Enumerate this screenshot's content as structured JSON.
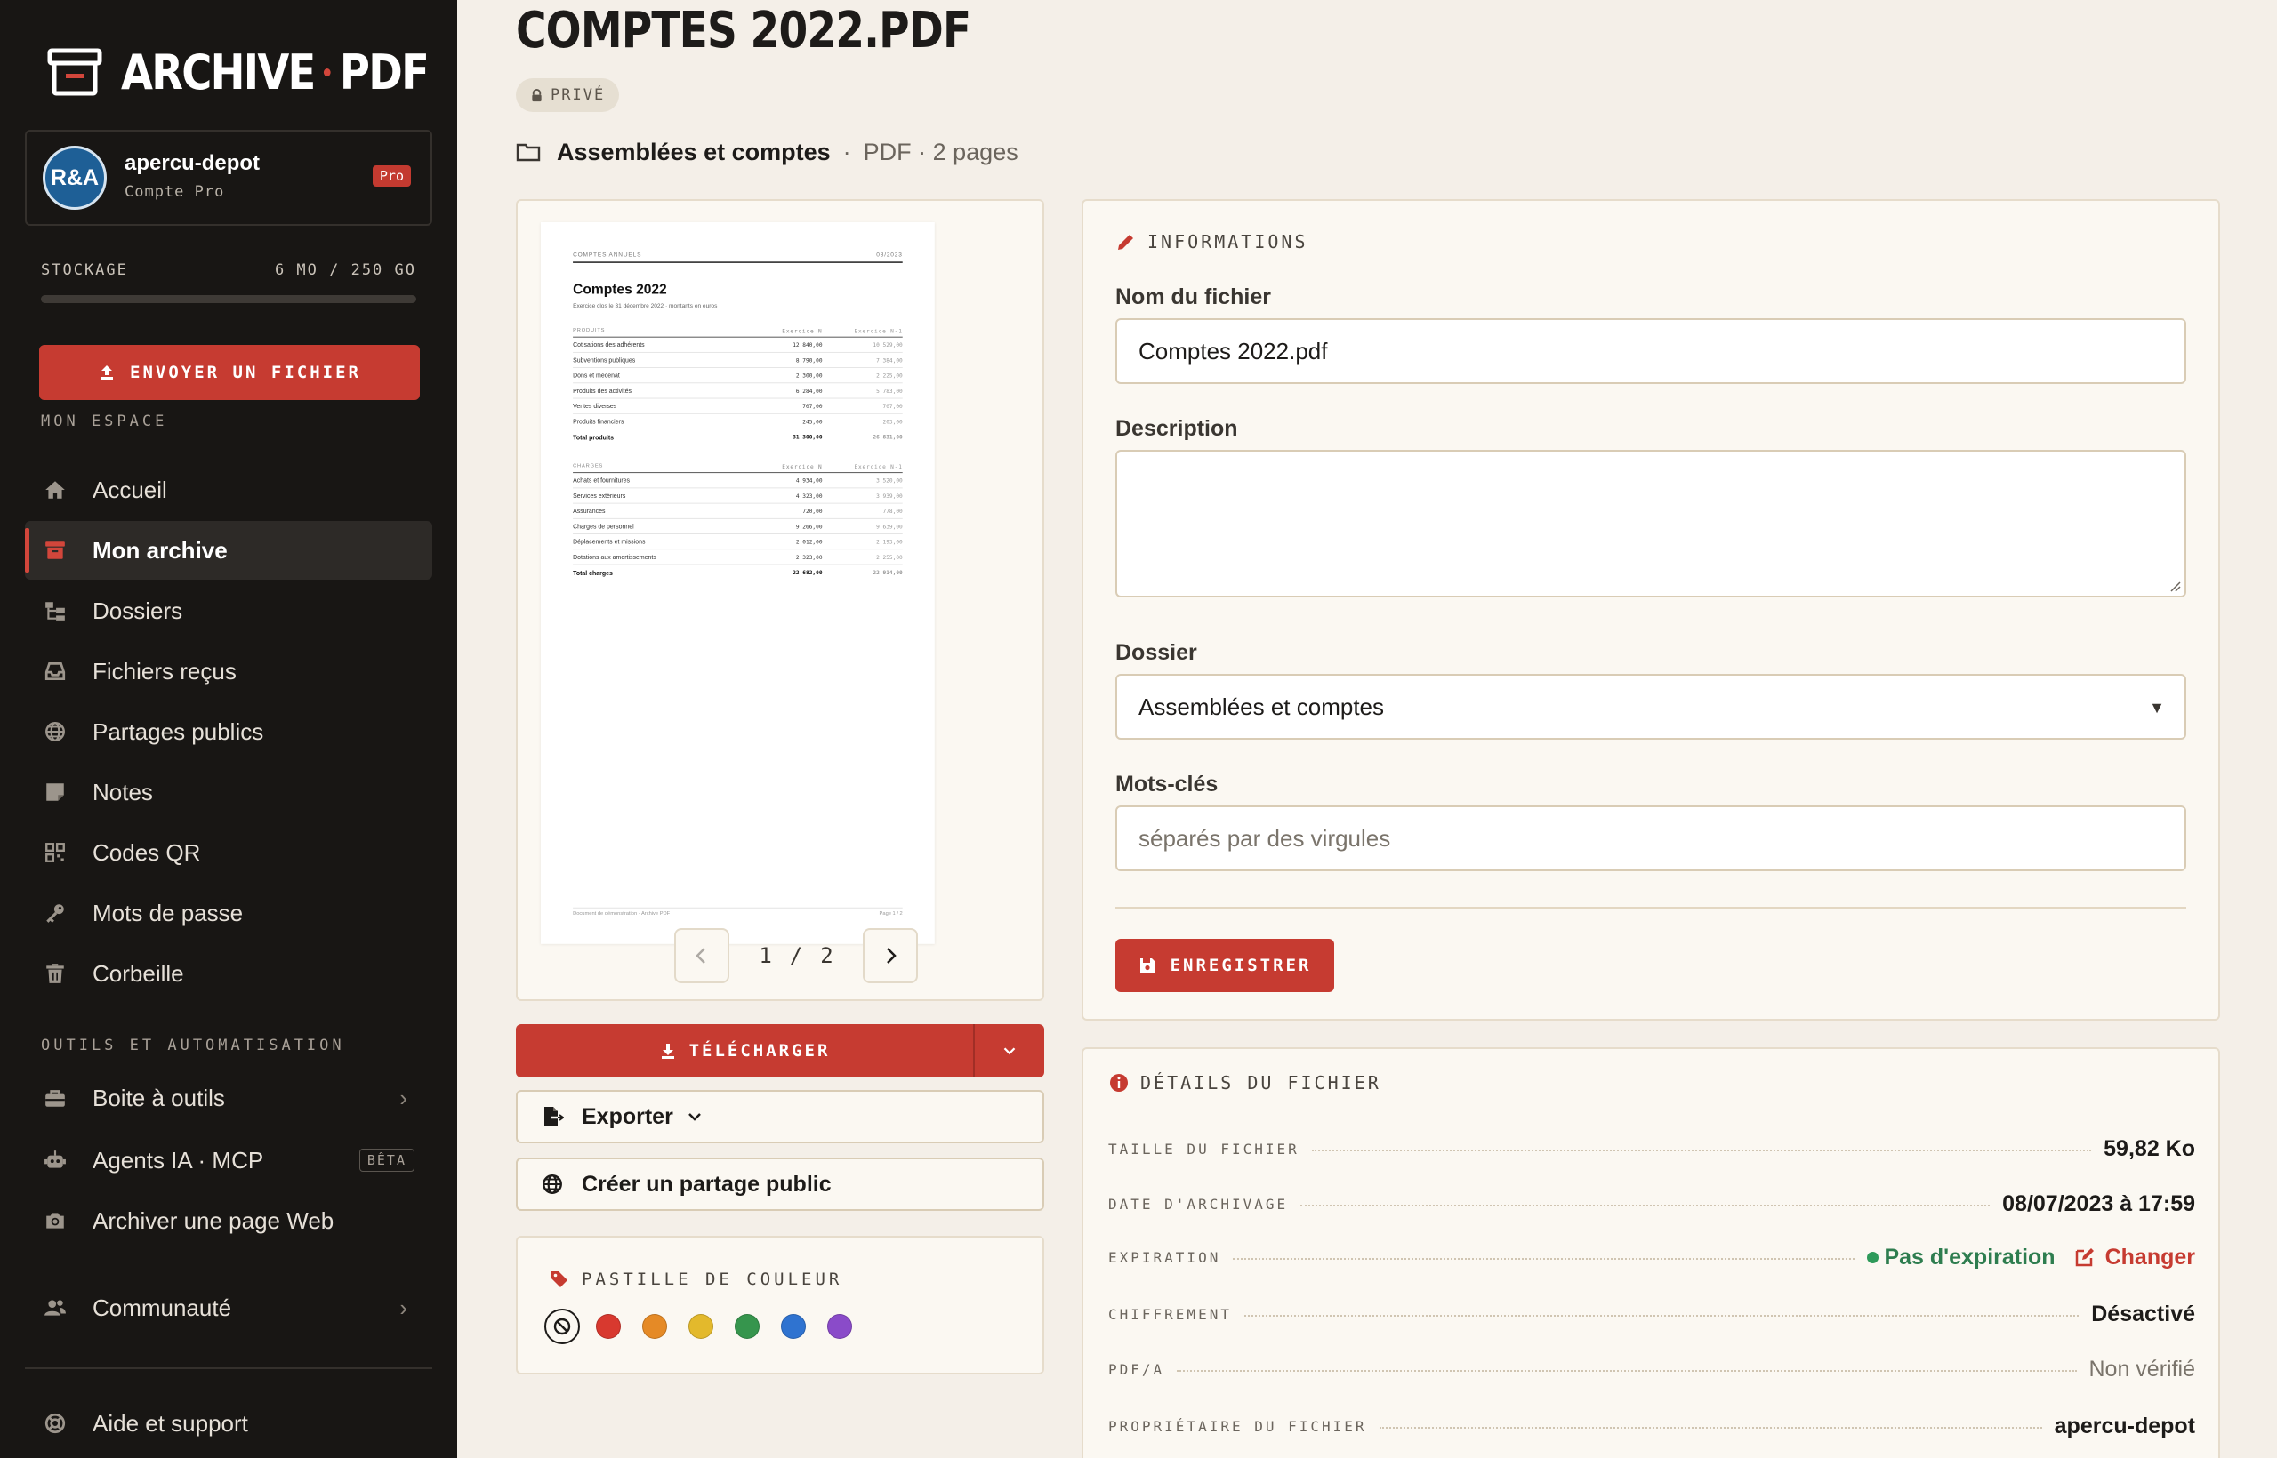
{
  "app": {
    "logo_left": "ARCHIVE",
    "logo_right": "PDF"
  },
  "account": {
    "avatar_text": "R&A",
    "name": "apercu-depot",
    "plan": "Compte Pro",
    "badge": "Pro"
  },
  "storage": {
    "label": "STOCKAGE",
    "value": "6 MO / 250 GO",
    "fraction_used": 0.0
  },
  "upload_button": "ENVOYER UN FICHIER",
  "sidebar": {
    "section_my_space": "MON ESPACE",
    "section_tools": "OUTILS ET AUTOMATISATION",
    "items": [
      {
        "label": "Accueil",
        "icon": "home-icon"
      },
      {
        "label": "Mon archive",
        "icon": "archive-box-icon",
        "active": true
      },
      {
        "label": "Dossiers",
        "icon": "folder-tree-icon"
      },
      {
        "label": "Fichiers reçus",
        "icon": "inbox-icon"
      },
      {
        "label": "Partages publics",
        "icon": "globe-icon"
      },
      {
        "label": "Notes",
        "icon": "note-icon"
      },
      {
        "label": "Codes QR",
        "icon": "qr-code-icon"
      },
      {
        "label": "Mots de passe",
        "icon": "key-icon"
      },
      {
        "label": "Corbeille",
        "icon": "trash-icon"
      }
    ],
    "tools": [
      {
        "label": "Boite à outils",
        "icon": "toolbox-icon"
      },
      {
        "label": "Agents IA · MCP",
        "icon": "robot-icon",
        "badge": "BÊTA"
      },
      {
        "label": "Archiver une page Web",
        "icon": "camera-icon"
      }
    ],
    "community": "Communauté",
    "help": "Aide et support"
  },
  "document": {
    "title": "COMPTES 2022.PDF",
    "visibility": "PRIVÉ",
    "folder": "Assemblées et comptes",
    "meta": "PDF · 2 pages"
  },
  "preview": {
    "page_current": "1",
    "page_sep": "/",
    "page_total": "2",
    "pdf": {
      "header_left": "COMPTES ANNUELS",
      "header_right": "08/2023",
      "title": "Comptes 2022",
      "subtitle": "Exercice clos le 31 décembre 2022 · montants en euros",
      "produits_header": [
        "PRODUITS",
        "Exercice N",
        "Exercice N-1"
      ],
      "produits": [
        [
          "Cotisations des adhérents",
          "12 840,00",
          "10 529,00"
        ],
        [
          "Subventions publiques",
          "8 790,00",
          "7 384,00"
        ],
        [
          "Dons et mécénat",
          "2 300,00",
          "2 225,00"
        ],
        [
          "Produits des activités",
          "6 284,00",
          "5 783,00"
        ],
        [
          "Ventes diverses",
          "707,00",
          "707,00"
        ],
        [
          "Produits financiers",
          "245,00",
          "203,00"
        ]
      ],
      "produits_total": [
        "Total produits",
        "31 300,00",
        "26 831,00"
      ],
      "charges_header": [
        "CHARGES",
        "Exercice N",
        "Exercice N-1"
      ],
      "charges": [
        [
          "Achats et fournitures",
          "4 934,00",
          "3 520,00"
        ],
        [
          "Services extérieurs",
          "4 323,00",
          "3 939,00"
        ],
        [
          "Assurances",
          "720,00",
          "778,00"
        ],
        [
          "Charges de personnel",
          "9 266,00",
          "9 639,00"
        ],
        [
          "Déplacements et missions",
          "2 012,00",
          "2 193,00"
        ],
        [
          "Dotations aux amortissements",
          "2 323,00",
          "2 255,00"
        ]
      ],
      "charges_total": [
        "Total charges",
        "22 682,00",
        "22 914,00"
      ],
      "footer_left": "Document de démonstration · Archive PDF",
      "footer_right": "Page 1 / 2"
    }
  },
  "actions": {
    "download": "TÉLÉCHARGER",
    "export": "Exporter",
    "public_share": "Créer un partage public"
  },
  "color_tag": {
    "label": "PASTILLE DE COULEUR",
    "colors": [
      "#d8392f",
      "#e58a26",
      "#e3b92c",
      "#36954d",
      "#2f73d0",
      "#8a4bc9"
    ]
  },
  "info_form": {
    "heading": "INFORMATIONS",
    "filename_label": "Nom du fichier",
    "filename_value": "Comptes 2022.pdf",
    "description_label": "Description",
    "description_value": "",
    "folder_label": "Dossier",
    "folder_value": "Assemblées et comptes",
    "keywords_label": "Mots-clés",
    "keywords_placeholder": "séparés par des virgules",
    "save": "ENREGISTRER"
  },
  "details": {
    "heading": "DÉTAILS DU FICHIER",
    "rows": [
      {
        "label": "TAILLE DU FICHIER",
        "value": "59,82 Ko"
      },
      {
        "label": "DATE D'ARCHIVAGE",
        "value": "08/07/2023 à 17:59"
      },
      {
        "label": "EXPIRATION",
        "value": "Pas d'expiration",
        "action": "Changer"
      },
      {
        "label": "CHIFFREMENT",
        "value": "Désactivé"
      },
      {
        "label": "PDF/A",
        "value": "Non vérifié"
      },
      {
        "label": "PROPRIÉTAIRE DU FICHIER",
        "value": "apercu-depot"
      }
    ]
  }
}
